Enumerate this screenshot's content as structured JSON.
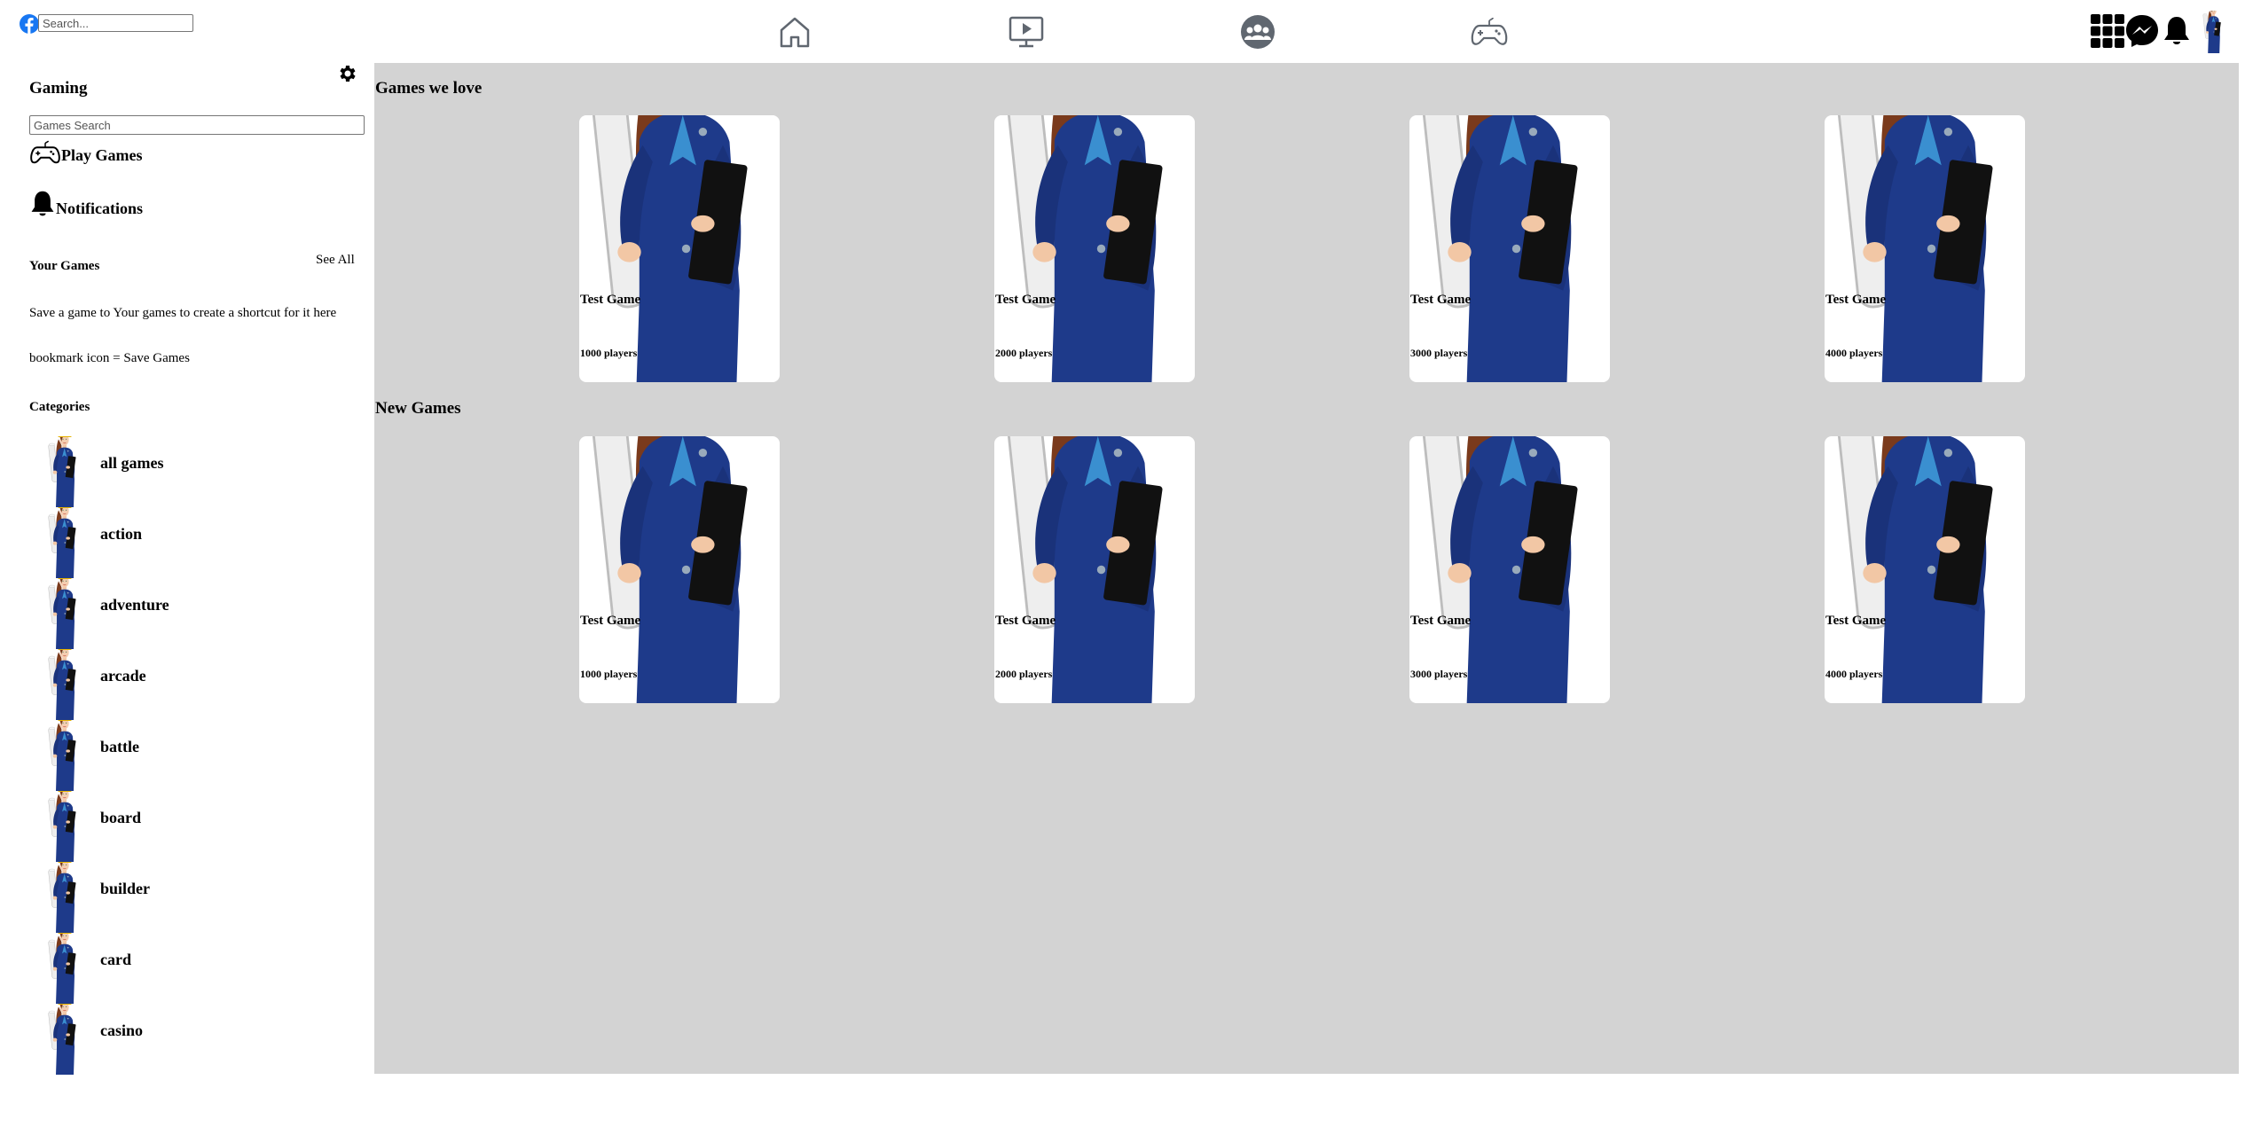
{
  "topbar": {
    "search_placeholder": "Search...",
    "nav_icons": [
      "home-icon",
      "watch-icon",
      "groups-icon",
      "gaming-icon"
    ],
    "right_icons": [
      "menu-grid-icon",
      "messenger-icon",
      "bell-icon",
      "avatar"
    ]
  },
  "sidebar": {
    "title": "Gaming",
    "search_placeholder": "Games Search",
    "play_games": "Play Games",
    "notifications": "Notifications",
    "your_games": "Your Games",
    "see_all": "See All",
    "save_hint": "Save a game to Your games to create a shortcut for it here",
    "bookmark_hint": "bookmark icon = Save Games",
    "categories_title": "Categories",
    "categories": [
      "all games",
      "action",
      "adventure",
      "arcade",
      "battle",
      "board",
      "builder",
      "card",
      "casino"
    ]
  },
  "main": {
    "sections": [
      {
        "title": "Games we love",
        "cards": [
          {
            "title": "Test Game",
            "players": "1000 players"
          },
          {
            "title": "Test Game",
            "players": "2000 players"
          },
          {
            "title": "Test Game",
            "players": "3000 players"
          },
          {
            "title": "Test Game",
            "players": "4000 players"
          }
        ]
      },
      {
        "title": "New Games",
        "cards": [
          {
            "title": "Test Game",
            "players": "1000 players"
          },
          {
            "title": "Test Game",
            "players": "2000 players"
          },
          {
            "title": "Test Game",
            "players": "3000 players"
          },
          {
            "title": "Test Game",
            "players": "4000 players"
          }
        ]
      }
    ]
  },
  "colors": {
    "facebook_blue": "#1877f2",
    "main_bg": "#d3d3d3",
    "nav_icon_gray": "#606770",
    "helmet_yellow": "#f6c90e",
    "suit_blue": "#1e3a8a"
  }
}
